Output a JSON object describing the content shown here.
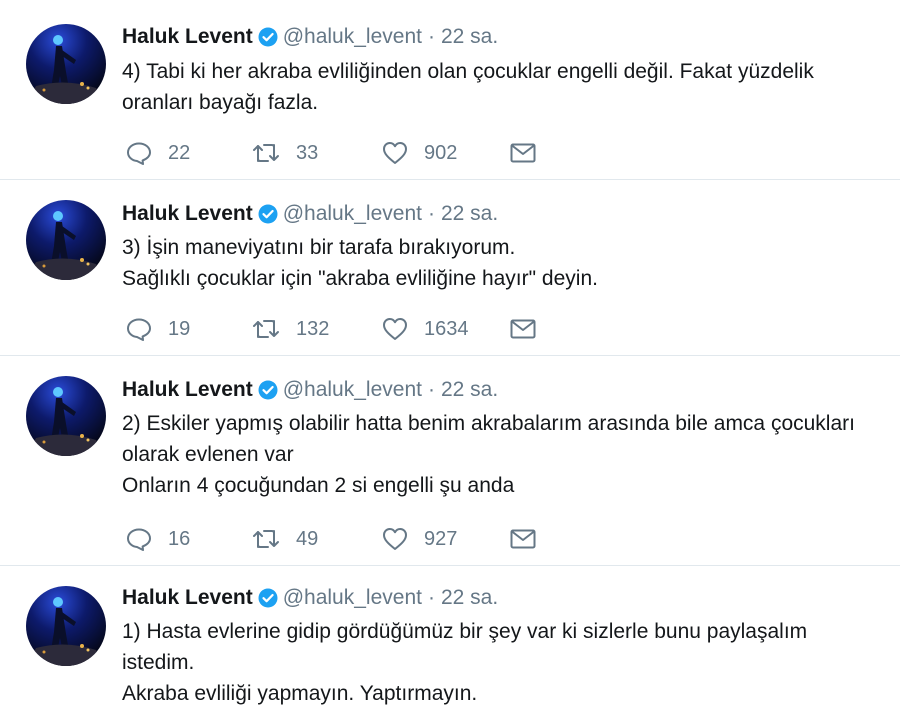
{
  "tweets": [
    {
      "author": "Haluk Levent",
      "handle": "@haluk_levent",
      "separator": "·",
      "time": "22 sa.",
      "lines": [
        "4) Tabi ki her akraba evliliğinden olan çocuklar engelli değil. Fakat yüzdelik",
        "oranları bayağı fazla."
      ],
      "replies": "22",
      "retweets": "33",
      "likes": "902"
    },
    {
      "author": "Haluk Levent",
      "handle": "@haluk_levent",
      "separator": "·",
      "time": "22 sa.",
      "lines": [
        "3) İşin maneviyatını bir tarafa bırakıyorum.",
        "Sağlıklı çocuklar için \"akraba evliliğine hayır\" deyin."
      ],
      "replies": "19",
      "retweets": "132",
      "likes": "1634"
    },
    {
      "author": "Haluk Levent",
      "handle": "@haluk_levent",
      "separator": "·",
      "time": "22 sa.",
      "lines": [
        "2) Eskiler yapmış olabilir hatta benim akrabalarım arasında bile amca çocukları",
        "olarak evlenen var",
        "Onların 4 çocuğundan 2 si engelli şu anda"
      ],
      "replies": "16",
      "retweets": "49",
      "likes": "927"
    },
    {
      "author": "Haluk Levent",
      "handle": "@haluk_levent",
      "separator": "·",
      "time": "22 sa.",
      "lines": [
        "1) Hasta evlerine gidip gördüğümüz bir şey var ki sizlerle bunu paylaşalım",
        "istedim.",
        "Akraba evliliği yapmayın. Yaptırmayın."
      ]
    }
  ],
  "icons": {
    "reply": "reply-icon",
    "retweet": "retweet-icon",
    "like": "heart-icon",
    "dm": "envelope-icon",
    "verified": "verified-badge-icon"
  },
  "colors": {
    "text": "#14171a",
    "muted": "#657786",
    "verified": "#1da1f2",
    "divider": "#e1e8ed"
  }
}
